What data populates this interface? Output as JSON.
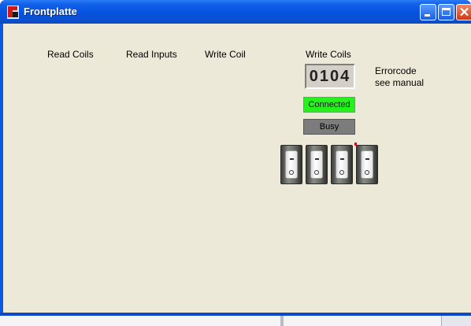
{
  "window": {
    "title": "Frontplatte",
    "controls": [
      "minimize",
      "maximize",
      "close"
    ]
  },
  "labels": {
    "read_coils": "Read Coils",
    "read_inputs": "Read Inputs",
    "write_coil": "Write Coil",
    "write_coils": "Write Coils",
    "errorcode_line1": "Errorcode",
    "errorcode_line2": "see manual"
  },
  "display": {
    "error_code": "0104"
  },
  "status": {
    "connected": "Connected",
    "busy": "Busy"
  },
  "colors": {
    "connected": "#23f31a",
    "busy": "#7c7c7c",
    "titlebar": "#0652de",
    "client": "#ece9d8"
  },
  "switches": [
    {
      "name": "coil-switch-1",
      "icon": "rocker-switch-icon"
    },
    {
      "name": "coil-switch-2",
      "icon": "rocker-switch-icon"
    },
    {
      "name": "coil-switch-3",
      "icon": "rocker-switch-icon"
    },
    {
      "name": "coil-switch-4",
      "icon": "rocker-switch-icon"
    }
  ]
}
